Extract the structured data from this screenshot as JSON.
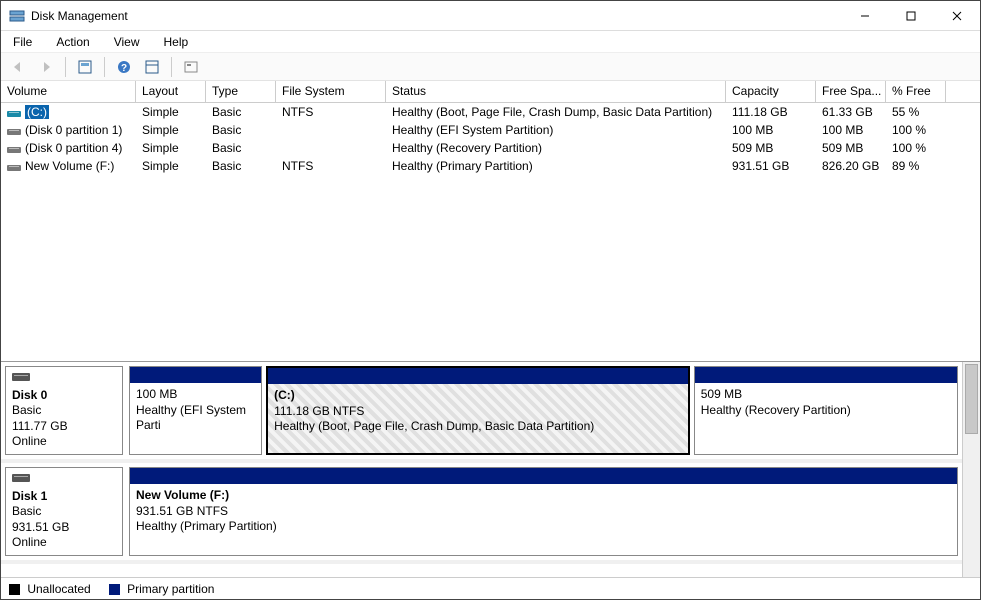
{
  "window": {
    "title": "Disk Management"
  },
  "menu": {
    "file": "File",
    "action": "Action",
    "view": "View",
    "help": "Help"
  },
  "columns": {
    "volume": "Volume",
    "layout": "Layout",
    "type": "Type",
    "fs": "File System",
    "status": "Status",
    "capacity": "Capacity",
    "free": "Free Spa...",
    "pct": "% Free"
  },
  "volumes": [
    {
      "name": "(C:)",
      "layout": "Simple",
      "type": "Basic",
      "fs": "NTFS",
      "status": "Healthy (Boot, Page File, Crash Dump, Basic Data Partition)",
      "capacity": "111.18 GB",
      "free": "61.33 GB",
      "pct": "55 %",
      "selected": true
    },
    {
      "name": "(Disk 0 partition 1)",
      "layout": "Simple",
      "type": "Basic",
      "fs": "",
      "status": "Healthy (EFI System Partition)",
      "capacity": "100 MB",
      "free": "100 MB",
      "pct": "100 %"
    },
    {
      "name": "(Disk 0 partition 4)",
      "layout": "Simple",
      "type": "Basic",
      "fs": "",
      "status": "Healthy (Recovery Partition)",
      "capacity": "509 MB",
      "free": "509 MB",
      "pct": "100 %"
    },
    {
      "name": "New Volume (F:)",
      "layout": "Simple",
      "type": "Basic",
      "fs": "NTFS",
      "status": "Healthy (Primary Partition)",
      "capacity": "931.51 GB",
      "free": "826.20 GB",
      "pct": "89 %"
    }
  ],
  "disks": [
    {
      "name": "Disk 0",
      "type": "Basic",
      "size": "111.77 GB",
      "state": "Online",
      "parts": [
        {
          "title": "",
          "line2": "100 MB",
          "line3": "Healthy (EFI System Parti",
          "flex": 15
        },
        {
          "title": "(C:)",
          "line2": "111.18 GB NTFS",
          "line3": "Healthy (Boot, Page File, Crash Dump, Basic Data Partition)",
          "flex": 48,
          "selected": true
        },
        {
          "title": "",
          "line2": "509 MB",
          "line3": "Healthy (Recovery Partition)",
          "flex": 30
        }
      ]
    },
    {
      "name": "Disk 1",
      "type": "Basic",
      "size": "931.51 GB",
      "state": "Online",
      "parts": [
        {
          "title": "New Volume  (F:)",
          "line2": "931.51 GB NTFS",
          "line3": "Healthy (Primary Partition)",
          "flex": 100
        }
      ]
    }
  ],
  "legend": {
    "unallocated": "Unallocated",
    "primary": "Primary partition"
  }
}
